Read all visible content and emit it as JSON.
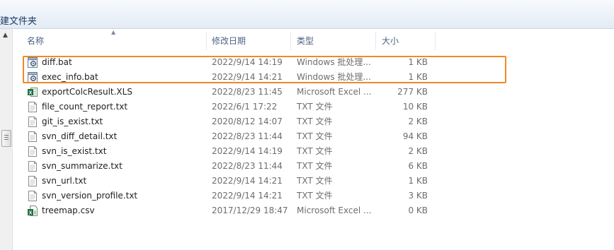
{
  "toolbar": {
    "new_folder": "建文件夹"
  },
  "columns": {
    "name": "名称",
    "date": "修改日期",
    "type": "类型",
    "size": "大小"
  },
  "files": [
    {
      "name": "diff.bat",
      "date": "2022/9/14 14:19",
      "type": "Windows 批处理...",
      "size": "1 KB",
      "icon": "batch-file-icon"
    },
    {
      "name": "exec_info.bat",
      "date": "2022/9/14 14:21",
      "type": "Windows 批处理...",
      "size": "1 KB",
      "icon": "batch-file-icon"
    },
    {
      "name": "exportColcResult.XLS",
      "date": "2022/8/23 11:45",
      "type": "Microsoft Excel ...",
      "size": "277 KB",
      "icon": "excel-file-icon"
    },
    {
      "name": "file_count_report.txt",
      "date": "2022/6/1 17:22",
      "type": "TXT 文件",
      "size": "10 KB",
      "icon": "text-file-icon"
    },
    {
      "name": "git_is_exist.txt",
      "date": "2020/8/12 14:07",
      "type": "TXT 文件",
      "size": "2 KB",
      "icon": "text-file-icon"
    },
    {
      "name": "svn_diff_detail.txt",
      "date": "2022/8/23 11:44",
      "type": "TXT 文件",
      "size": "94 KB",
      "icon": "text-file-icon"
    },
    {
      "name": "svn_is_exist.txt",
      "date": "2022/9/14 14:19",
      "type": "TXT 文件",
      "size": "2 KB",
      "icon": "text-file-icon"
    },
    {
      "name": "svn_summarize.txt",
      "date": "2022/8/23 11:44",
      "type": "TXT 文件",
      "size": "6 KB",
      "icon": "text-file-icon"
    },
    {
      "name": "svn_url.txt",
      "date": "2022/9/14 14:21",
      "type": "TXT 文件",
      "size": "1 KB",
      "icon": "text-file-icon"
    },
    {
      "name": "svn_version_profile.txt",
      "date": "2022/9/14 14:21",
      "type": "TXT 文件",
      "size": "3 KB",
      "icon": "text-file-icon"
    },
    {
      "name": "treemap.csv",
      "date": "2017/12/29 18:47",
      "type": "Microsoft Excel ...",
      "size": "0 KB",
      "icon": "excel-csv-icon"
    }
  ],
  "colors": {
    "highlight": "#f08a24",
    "header_text": "#4d6185",
    "excel_green": "#1d7044"
  }
}
